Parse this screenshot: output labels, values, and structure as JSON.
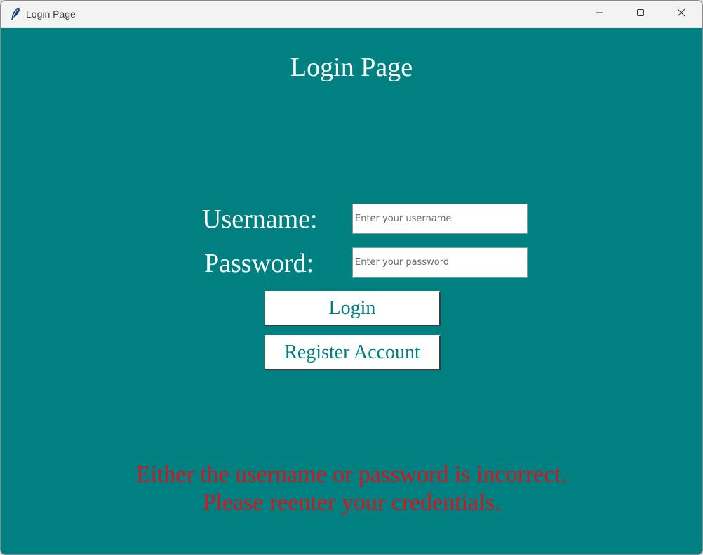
{
  "window": {
    "title": "Login Page",
    "icon": "feather-icon",
    "controls": {
      "minimize": "minimize-icon",
      "maximize": "maximize-icon",
      "close": "close-icon"
    }
  },
  "page": {
    "title": "Login Page",
    "background_color": "#008080"
  },
  "form": {
    "username_label": "Username:",
    "username_placeholder": "Enter your username",
    "username_value": "",
    "password_label": "Password:",
    "password_placeholder": "Enter your password",
    "password_value": "",
    "login_label": "Login",
    "register_label": "Register Account"
  },
  "error": {
    "line1": "Either the username or password is incorrect.",
    "line2": "Please reenter your credentials.",
    "color": "#e0101a"
  }
}
